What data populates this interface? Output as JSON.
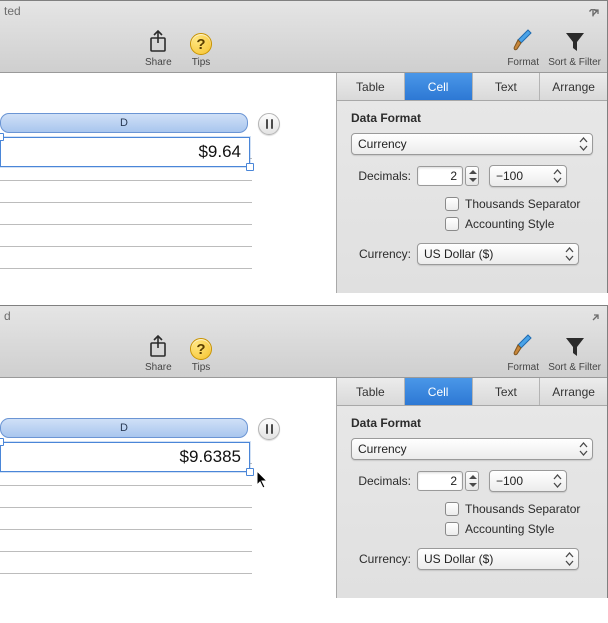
{
  "windows": [
    {
      "title_fragment": "ted",
      "toolbar": {
        "share": "Share",
        "tips": "Tips",
        "format": "Format",
        "sort": "Sort & Filter"
      },
      "sheet": {
        "column_letter": "D",
        "cell_value": "$9.64"
      },
      "inspector": {
        "tabs": {
          "table": "Table",
          "cell": "Cell",
          "text": "Text",
          "arrange": "Arrange",
          "selected": "cell"
        },
        "section": "Data Format",
        "format_type": "Currency",
        "decimals_label": "Decimals:",
        "decimals_value": "2",
        "negative_style": "−100",
        "thousands_label": "Thousands Separator",
        "thousands_checked": false,
        "accounting_label": "Accounting Style",
        "accounting_checked": false,
        "currency_label": "Currency:",
        "currency_value": "US Dollar ($)"
      }
    },
    {
      "title_fragment": "d",
      "toolbar": {
        "share": "Share",
        "tips": "Tips",
        "format": "Format",
        "sort": "Sort & Filter"
      },
      "sheet": {
        "column_letter": "D",
        "cell_value": "$9.6385"
      },
      "inspector": {
        "tabs": {
          "table": "Table",
          "cell": "Cell",
          "text": "Text",
          "arrange": "Arrange",
          "selected": "cell"
        },
        "section": "Data Format",
        "format_type": "Currency",
        "decimals_label": "Decimals:",
        "decimals_value": "2",
        "negative_style": "−100",
        "thousands_label": "Thousands Separator",
        "thousands_checked": false,
        "accounting_label": "Accounting Style",
        "accounting_checked": false,
        "currency_label": "Currency:",
        "currency_value": "US Dollar ($)"
      }
    }
  ]
}
